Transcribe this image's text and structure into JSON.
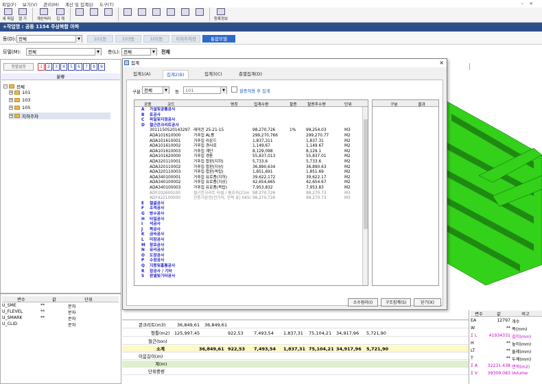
{
  "menu": [
    "파일(F)",
    "보기(V)",
    "관리(M)",
    "계산 및 집계(J)",
    "도구(T)"
  ],
  "toolbar": {
    "new_label": "새 파일",
    "open_label": "열 기",
    "calc_label": "계산처리",
    "sum_label": "집 계",
    "reg_label": "등록정보"
  },
  "project_title": "+작업명 : 공동 1154 주상복합 아파",
  "dong": {
    "label": "동(D):",
    "value": "전체",
    "tabs": [
      "101동",
      "103동",
      "105동",
      "지하주차장",
      "통합모델"
    ],
    "active_index": 4
  },
  "model": {
    "label": "모델(M):",
    "value": "전체",
    "floor_label": "층(L):",
    "floor_value": "전체",
    "floor_text": "전체"
  },
  "left": {
    "filter_label": "정렬설정",
    "numbers": [
      "1",
      "2",
      "3",
      "4",
      "5",
      "6",
      "7",
      "8",
      "9"
    ],
    "header": "분류",
    "tree": [
      "전체",
      "101",
      "103",
      "105",
      "지하주차"
    ]
  },
  "vars": {
    "headers": [
      "변수",
      "값",
      "단위"
    ],
    "rows": [
      {
        "name": "U_SME",
        "val": "**",
        "unit": "문자"
      },
      {
        "name": "U_FLEVEL",
        "val": "**",
        "unit": "문자"
      },
      {
        "name": "U_SMARK",
        "val": "**",
        "unit": "문자"
      },
      {
        "name": "U_CLID",
        "val": "",
        "unit": "문자"
      }
    ]
  },
  "dialog": {
    "title": "집계",
    "tabs": [
      "집계1(A)",
      "집계2(B)",
      "집계3(C)",
      "층별집계(D)"
    ],
    "active_tab": 1,
    "filter": {
      "gubun_label": "구분",
      "gubun_value": "전체",
      "dong_label": "동",
      "dong_value": "101",
      "apply_label": "할증적용 후 집계"
    },
    "headers": [
      "공종",
      "코드",
      "명칭",
      "집계수량",
      "할증",
      "할증후수량",
      "단위"
    ],
    "rows": [
      {
        "c": "A",
        "code": "가설및공통공사",
        "name": "",
        "q": "",
        "h": "",
        "hq": "",
        "u": "",
        "t": "cat"
      },
      {
        "c": "B",
        "code": "토공사",
        "name": "",
        "q": "",
        "h": "",
        "hq": "",
        "u": "",
        "t": "cat"
      },
      {
        "c": "C",
        "code": "파일및지정공사",
        "name": "",
        "q": "",
        "h": "",
        "hq": "",
        "u": "",
        "t": "cat"
      },
      {
        "c": "D",
        "code": "철근콘크리트공사",
        "name": "",
        "q": "",
        "h": "",
        "hq": "",
        "u": "",
        "t": "cat"
      },
      {
        "c": "",
        "code": "3011150520143297",
        "name": "레미콘 25-21-15",
        "q": "98,270,726",
        "h": "1%",
        "hq": "99,254.03",
        "u": "M3",
        "t": "n"
      },
      {
        "c": "",
        "code": "ADA101610000",
        "name": "거푸집 AL폼",
        "q": "299,270,766",
        "h": "",
        "hq": "299,270.77",
        "u": "M2",
        "t": "n"
      },
      {
        "c": "",
        "code": "ADA101610001",
        "name": "거푸집 라운드",
        "q": "1,837,311",
        "h": "",
        "hq": "1,837.31",
        "u": "M2",
        "t": "n"
      },
      {
        "c": "",
        "code": "ADA101610002",
        "name": "거푸집 경사로",
        "q": "1,149,67",
        "h": "",
        "hq": "1,149.67",
        "u": "M2",
        "t": "n"
      },
      {
        "c": "",
        "code": "ADA101610003",
        "name": "거푸집 계단",
        "q": "8,129,098",
        "h": "",
        "hq": "8,129.1",
        "u": "M2",
        "t": "n"
      },
      {
        "c": "",
        "code": "ADA101620000",
        "name": "거푸집 경톤",
        "q": "55,837,013",
        "h": "",
        "hq": "55,837.01",
        "u": "M2",
        "t": "n"
      },
      {
        "c": "",
        "code": "ADA320110001",
        "name": "거푸집 합판(지하)",
        "q": "5,733,6",
        "h": "",
        "hq": "5,733.6",
        "u": "M2",
        "t": "n"
      },
      {
        "c": "",
        "code": "ADA320110002",
        "name": "거푸집 합판(지상)",
        "q": "36,890,634",
        "h": "",
        "hq": "36,890.63",
        "u": "M2",
        "t": "n"
      },
      {
        "c": "",
        "code": "ADA320110003",
        "name": "거푸집 합판(옥탑)",
        "q": "1,851,691",
        "h": "",
        "hq": "1,851.69",
        "u": "M2",
        "t": "n"
      },
      {
        "c": "",
        "code": "ADA340100001",
        "name": "거푸집 유로폼(지하)",
        "q": "39,622,172",
        "h": "",
        "hq": "39,622.17",
        "u": "M2",
        "t": "n"
      },
      {
        "c": "",
        "code": "ADA340100002",
        "name": "거푸집 유로폼(지상)",
        "q": "42,654,665",
        "h": "",
        "hq": "42,654.67",
        "u": "M2",
        "t": "n"
      },
      {
        "c": "",
        "code": "ADA340100003",
        "name": "거푸집 유로폼(옥탑)",
        "q": "7,953,832",
        "h": "",
        "hq": "7,953.83",
        "u": "M2",
        "t": "n"
      },
      {
        "c": "",
        "code": "ADF202600100",
        "name": "철근콘크리트 타설 / 펌프카(21m",
        "q": "98,270,726",
        "h": "",
        "hq": "98,270.73",
        "u": "M3",
        "t": "g"
      },
      {
        "c": "",
        "code": "ADF422100000",
        "name": "진동기운전(전기식, 인력 유) 045i",
        "q": "98,270,726",
        "h": "",
        "hq": "98,270.73",
        "u": "M3",
        "t": "g"
      },
      {
        "c": "E",
        "code": "철골공사",
        "name": "",
        "q": "",
        "h": "",
        "hq": "",
        "u": "",
        "t": "cat"
      },
      {
        "c": "F",
        "code": "조적공사",
        "name": "",
        "q": "",
        "h": "",
        "hq": "",
        "u": "",
        "t": "cat"
      },
      {
        "c": "G",
        "code": "방수공사",
        "name": "",
        "q": "",
        "h": "",
        "hq": "",
        "u": "",
        "t": "cat"
      },
      {
        "c": "H",
        "code": "타일공사",
        "name": "",
        "q": "",
        "h": "",
        "hq": "",
        "u": "",
        "t": "cat"
      },
      {
        "c": "I",
        "code": "석공사",
        "name": "",
        "q": "",
        "h": "",
        "hq": "",
        "u": "",
        "t": "cat"
      },
      {
        "c": "J",
        "code": "목공사",
        "name": "",
        "q": "",
        "h": "",
        "hq": "",
        "u": "",
        "t": "cat"
      },
      {
        "c": "K",
        "code": "금속공사",
        "name": "",
        "q": "",
        "h": "",
        "hq": "",
        "u": "",
        "t": "cat"
      },
      {
        "c": "L",
        "code": "미장공사",
        "name": "",
        "q": "",
        "h": "",
        "hq": "",
        "u": "",
        "t": "cat"
      },
      {
        "c": "M",
        "code": "창호공사",
        "name": "",
        "q": "",
        "h": "",
        "hq": "",
        "u": "",
        "t": "cat"
      },
      {
        "c": "N",
        "code": "유리공사",
        "name": "",
        "q": "",
        "h": "",
        "hq": "",
        "u": "",
        "t": "cat"
      },
      {
        "c": "O",
        "code": "도장공사",
        "name": "",
        "q": "",
        "h": "",
        "hq": "",
        "u": "",
        "t": "cat"
      },
      {
        "c": "P",
        "code": "수장공사",
        "name": "",
        "q": "",
        "h": "",
        "hq": "",
        "u": "",
        "t": "cat"
      },
      {
        "c": "Q",
        "code": "지붕및홈통공사",
        "name": "",
        "q": "",
        "h": "",
        "hq": "",
        "u": "",
        "t": "cat"
      },
      {
        "c": "R",
        "code": "잡공사 / 기타",
        "name": "",
        "q": "",
        "h": "",
        "hq": "",
        "u": "",
        "t": "cat"
      },
      {
        "c": "S",
        "code": "판넬및기타공사",
        "name": "",
        "q": "",
        "h": "",
        "hq": "",
        "u": "",
        "t": "cat"
      }
    ],
    "grid2_headers": [
      "구분",
      "결과"
    ],
    "buttons": {
      "round_label": "소수점리(I)",
      "struct_label": "구조집계(S)",
      "close_label": "닫기(X)"
    }
  },
  "bottom": {
    "rows": [
      {
        "name": "콘크리트(m3)",
        "a": "36,849,61",
        "b": "36,849,61",
        "c": "",
        "d": "",
        "e": "",
        "f": "",
        "g": "",
        "h": ""
      },
      {
        "name": "형틀(m2)",
        "a": "125,997,45",
        "b": "",
        "c": "922,53",
        "d": "7,493,54",
        "e": "1,837,31",
        "f": "75,104,21",
        "g": "34,917,96",
        "h": "5,721,90"
      },
      {
        "name": "철근(ton)",
        "a": "",
        "b": "",
        "c": "",
        "d": "",
        "e": "",
        "f": "",
        "g": "",
        "h": ""
      },
      {
        "name": "소계",
        "a": "",
        "b": "36,849,61",
        "c": "922,53",
        "d": "7,493,54",
        "e": "1,837,31",
        "f": "75,104,21",
        "g": "34,917,96",
        "h": "5,721,90"
      },
      {
        "name": "이음길이(m)",
        "a": "",
        "b": "",
        "c": "",
        "d": "",
        "e": "",
        "f": "",
        "g": "",
        "h": ""
      },
      {
        "name": "계(m)",
        "a": "",
        "b": "",
        "c": "",
        "d": "",
        "e": "",
        "f": "",
        "g": "",
        "h": ""
      },
      {
        "name": "단위중량",
        "a": "",
        "b": "",
        "c": "",
        "d": "",
        "e": "",
        "f": "",
        "g": "",
        "h": ""
      }
    ]
  },
  "rightvars": {
    "headers": [
      "변수",
      "값",
      "비고"
    ],
    "rows": [
      {
        "n": "EA",
        "v": "12797",
        "r": "개수",
        "p": false
      },
      {
        "n": "W",
        "v": "**",
        "r": "폭(mm)",
        "p": false
      },
      {
        "n": "Σ L",
        "v": "41934331",
        "r": "길이(mm)",
        "p": true
      },
      {
        "n": "H",
        "v": "**",
        "r": "높이(mm)",
        "p": false
      },
      {
        "n": "LT",
        "v": "**",
        "r": "둘레(mm)",
        "p": false
      },
      {
        "n": "T",
        "v": "**",
        "r": "두께(mm)",
        "p": false
      },
      {
        "n": "Σ A",
        "v": "32231.438",
        "r": "면적(m2)",
        "p": true
      },
      {
        "n": "Σ V",
        "v": "39309.083",
        "r": "Volume",
        "p": true
      }
    ]
  }
}
